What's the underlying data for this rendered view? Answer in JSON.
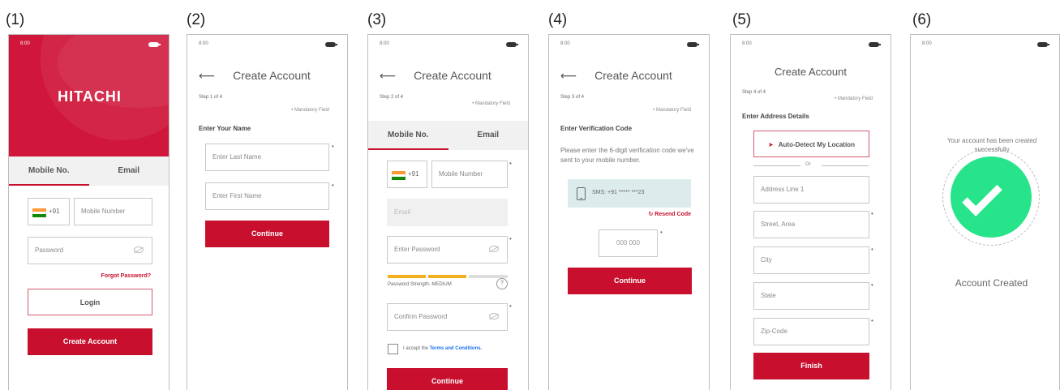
{
  "panels": [
    {
      "number": "(1)",
      "time": "8:00",
      "logo": "HITACHI",
      "tabs": {
        "mobile": "Mobile No.",
        "email": "Email"
      },
      "country_code": "+91",
      "mobile_placeholder": "Mobile Number",
      "password_placeholder": "Password",
      "forgot_password": "Forgot Password?",
      "login": "Login",
      "create_account": "Create Account"
    },
    {
      "number": "(2)",
      "time": "8:00",
      "title": "Create Account",
      "step": "Step 1 of 4",
      "mandatory": "Mandatory Field",
      "section": "Enter Your Name",
      "last_name_placeholder": "Enter Last Name",
      "first_name_placeholder": "Enter First Name",
      "continue": "Continue"
    },
    {
      "number": "(3)",
      "time": "8:00",
      "title": "Create Account",
      "step": "Step 2 of 4",
      "mandatory": "Mandatory Field",
      "tabs": {
        "mobile": "Mobile No.",
        "email": "Email"
      },
      "country_code": "+91",
      "mobile_placeholder": "Mobile Number",
      "email_placeholder": "Email",
      "password_placeholder": "Enter Password",
      "strength_label": "Password Strength- MEDIUM",
      "strength_fraction": 0.66,
      "strength_color": "#f2b01e",
      "help": "?",
      "confirm_placeholder": "Confirm Password",
      "accept_prefix": "I accept the ",
      "terms_link": "Terms and Conditions.",
      "continue": "Continue"
    },
    {
      "number": "(4)",
      "time": "8:00",
      "title": "Create Account",
      "step": "Step 3 of 4",
      "mandatory": "Mandatory Field",
      "section": "Enter Verification Code",
      "instructions": "Please enter the 6-digit verification code we've sent to your mobile number.",
      "sms_text": "SMS: +91 ***** ***23",
      "resend": "Resend Code",
      "code_placeholder": "000 000",
      "continue": "Continue"
    },
    {
      "number": "(5)",
      "time": "8:00",
      "title": "Create Account",
      "step": "Step 4 of 4",
      "mandatory": "Mandatory Field",
      "section": "Enter Address Details",
      "auto_detect": "Auto-Detect My Location",
      "or": "Or",
      "address1": "Address Line 1",
      "street": "Street, Area",
      "city": "City",
      "state": "State",
      "zip": "Zip-Code",
      "finish": "Finish"
    },
    {
      "number": "(6)",
      "time": "8:00",
      "message": "Your account has been created successfully",
      "status": "Account Created"
    }
  ],
  "colors": {
    "brand_red": "#c8102e",
    "success_green": "#27e48a",
    "sms_bg": "#dcecec"
  }
}
